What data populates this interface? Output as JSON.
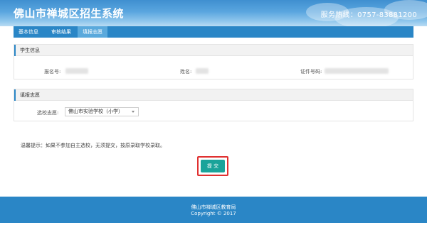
{
  "header": {
    "title": "佛山市禅城区招生系统",
    "hotline": "服务热线：0757-83881200"
  },
  "nav": {
    "items": [
      {
        "label": "基本信息",
        "active": false
      },
      {
        "label": "审核结果",
        "active": false
      },
      {
        "label": "填报志愿",
        "active": true
      }
    ]
  },
  "student_info": {
    "title": "学生信息",
    "registration_label": "报名号:",
    "name_label": "姓名:",
    "id_label": "证件号码:"
  },
  "preference": {
    "title": "填报志愿",
    "school_label": "选校志愿:",
    "school_selected": "佛山市实验学校（小学）"
  },
  "tip": "温馨提示：如果不参加自主选校，无须提交，按原录取学校录取。",
  "submit_label": "提 交",
  "footer": {
    "org": "佛山市禅城区教育局",
    "copyright": "Copyright © 2017"
  },
  "colors": {
    "header_blue": "#3f8fd0",
    "nav_blue": "#2a86c6",
    "submit_teal": "#1aa39a",
    "highlight_red": "#e03030"
  }
}
